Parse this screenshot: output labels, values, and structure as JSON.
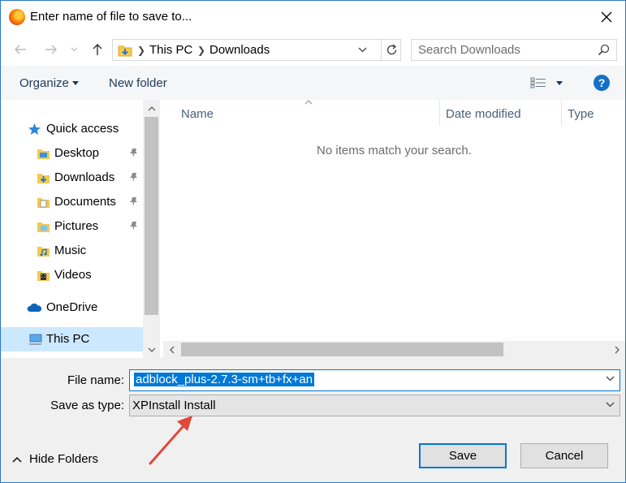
{
  "window": {
    "title": "Enter name of file to save to...",
    "app_icon": "firefox-icon"
  },
  "address": {
    "crumbs": [
      "This PC",
      "Downloads"
    ],
    "search_placeholder": "Search Downloads"
  },
  "toolbar": {
    "organize_label": "Organize",
    "new_folder_label": "New folder",
    "help_label": "?"
  },
  "nav": {
    "items": [
      {
        "label": "Quick access",
        "icon": "star-icon",
        "pinned": false
      },
      {
        "label": "Desktop",
        "icon": "desktop-folder-icon",
        "pinned": true
      },
      {
        "label": "Downloads",
        "icon": "downloads-folder-icon",
        "pinned": true
      },
      {
        "label": "Documents",
        "icon": "documents-folder-icon",
        "pinned": true
      },
      {
        "label": "Pictures",
        "icon": "pictures-folder-icon",
        "pinned": true
      },
      {
        "label": "Music",
        "icon": "music-folder-icon",
        "pinned": false
      },
      {
        "label": "Videos",
        "icon": "videos-folder-icon",
        "pinned": false
      },
      {
        "label": "OneDrive",
        "icon": "cloud-icon",
        "pinned": false
      },
      {
        "label": "This PC",
        "icon": "computer-icon",
        "pinned": false,
        "selected": true
      }
    ]
  },
  "filelist": {
    "columns": [
      "Name",
      "Date modified",
      "Type"
    ],
    "empty_message": "No items match your search."
  },
  "form": {
    "file_name_label": "File name:",
    "file_name_value": "adblock_plus-2.7.3-sm+tb+fx+an",
    "save_type_label": "Save as type:",
    "save_type_value": "XPInstall Install"
  },
  "footer": {
    "hide_folders_label": "Hide Folders",
    "save_label": "Save",
    "cancel_label": "Cancel"
  },
  "colors": {
    "accent": "#0078d7",
    "annotation_arrow": "#e0483a",
    "selected_nav": "#cce8ff"
  }
}
